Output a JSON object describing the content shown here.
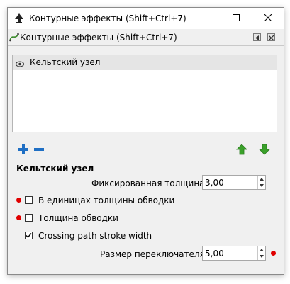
{
  "window": {
    "title": "Контурные эффекты (Shift+Ctrl+7)",
    "icons": {
      "app": "inkscape-icon",
      "minimize": "minimize-icon",
      "maximize": "maximize-icon",
      "close": "close-icon"
    }
  },
  "panel": {
    "title": "Контурные эффекты (Shift+Ctrl+7)",
    "icons": {
      "panel": "path-effect-icon",
      "dock": "dock-icon",
      "close": "panel-close-icon"
    }
  },
  "effects_list": {
    "items": [
      {
        "label": "Кельтский узел",
        "visible_icon": "eye-icon",
        "selected": true
      }
    ]
  },
  "toolbar": {
    "icons": [
      "add-icon",
      "remove-icon",
      "move-up-icon",
      "move-down-icon"
    ]
  },
  "effect_settings": {
    "title": "Кельтский узел",
    "fixed_width": {
      "label": "Фиксированная толщина:",
      "value": "3,00"
    },
    "in_stroke_width_units": {
      "label": "В единицах толщины обводки",
      "checked": false
    },
    "stroke_width": {
      "label": "Толщина обводки",
      "checked": false
    },
    "crossing_path_stroke_width": {
      "label": "Crossing path stroke width",
      "checked": true
    },
    "switcher_size": {
      "label": "Размер переключателя:",
      "value": "5,00"
    }
  },
  "colors": {
    "marker_dot": "#e00000",
    "arrow_green": "#3aa12a",
    "plus_blue": "#1f6fc4"
  }
}
